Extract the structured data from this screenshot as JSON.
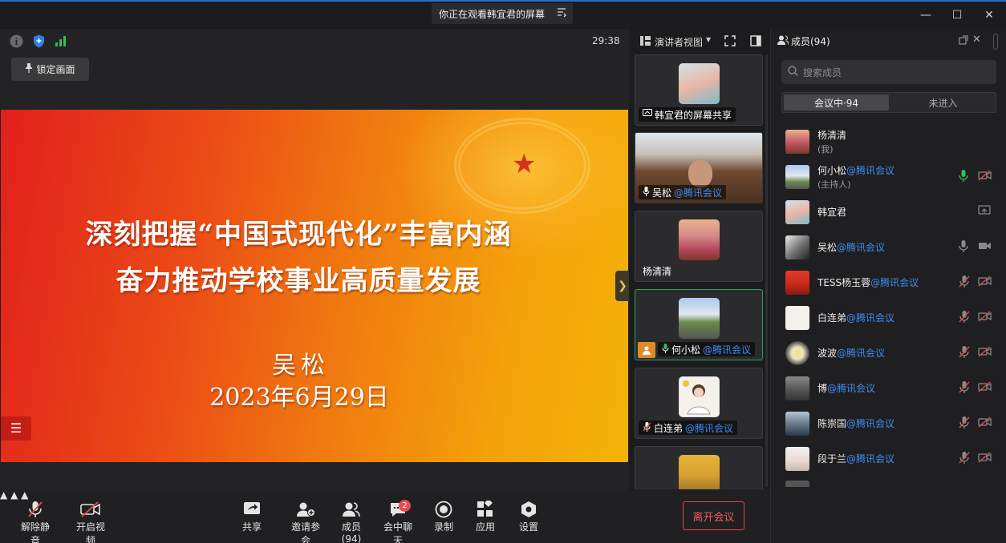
{
  "titlebar": {
    "banner": "你正在观看韩宜君的屏幕",
    "minimize": "—",
    "maximize": "☐",
    "close": "✕"
  },
  "stage": {
    "lock_label": "锁定画面",
    "timer": "29:38"
  },
  "slide": {
    "title_line1": "深刻把握“中国式现代化”丰富内涵",
    "title_line2": "奋力推动学校事业高质量发展",
    "author": "吴松",
    "date": "2023年6月29日"
  },
  "thumb_header": {
    "view_label": "演讲者视图"
  },
  "thumbnails": [
    {
      "name": "韩宜君的屏幕共享",
      "suffix": ""
    },
    {
      "name": "吴松",
      "suffix": "@腾讯会议"
    },
    {
      "name": "杨清清",
      "suffix": ""
    },
    {
      "name": "何小松",
      "suffix": "@腾讯会议"
    },
    {
      "name": "白连弟",
      "suffix": "@腾讯会议"
    }
  ],
  "panel": {
    "title": "成员(94)",
    "search_placeholder": "搜索成员",
    "tab_in_meeting": "会议中·94",
    "tab_not_joined": "未进入"
  },
  "members": [
    {
      "name": "杨清清",
      "suffix": "",
      "sub": "(我)"
    },
    {
      "name": "何小松",
      "suffix": "@腾讯会议",
      "sub": "(主持人)"
    },
    {
      "name": "韩宜君",
      "suffix": "",
      "sub": ""
    },
    {
      "name": "吴松",
      "suffix": "@腾讯会议",
      "sub": ""
    },
    {
      "name": "TESS杨玉蓉",
      "suffix": "@腾讯会议",
      "sub": ""
    },
    {
      "name": "白连弟",
      "suffix": "@腾讯会议",
      "sub": ""
    },
    {
      "name": "波波",
      "suffix": "@腾讯会议",
      "sub": ""
    },
    {
      "name": "博",
      "suffix": "@腾讯会议",
      "sub": ""
    },
    {
      "name": "陈崇国",
      "suffix": "@腾讯会议",
      "sub": ""
    },
    {
      "name": "段于兰",
      "suffix": "@腾讯会议",
      "sub": ""
    }
  ],
  "toolbar": {
    "unmute": "解除静音",
    "start_video": "开启视频",
    "share": "共享",
    "invite": "邀请参会",
    "members": "成员(94)",
    "chat": "会中聊天",
    "chat_badge": "2",
    "record": "录制",
    "apps": "应用",
    "settings": "设置",
    "leave": "离开会议"
  },
  "colors": {
    "accent_blue": "#3d8cf0",
    "active_green": "#2e9e5a",
    "leave_red": "#e64545"
  }
}
